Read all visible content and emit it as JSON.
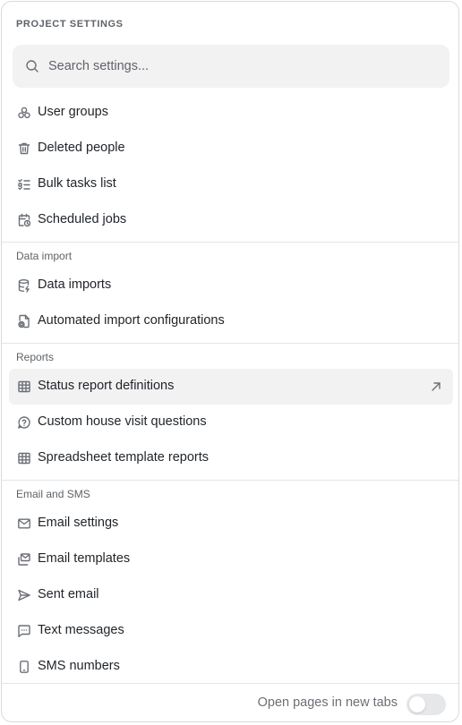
{
  "header": {
    "title": "PROJECT SETTINGS"
  },
  "search": {
    "placeholder": "Search settings..."
  },
  "sections": {
    "general": {
      "items": [
        {
          "label": "User groups",
          "icon": "user-groups-icon"
        },
        {
          "label": "Deleted people",
          "icon": "trash-icon"
        },
        {
          "label": "Bulk tasks list",
          "icon": "checklist-icon"
        },
        {
          "label": "Scheduled jobs",
          "icon": "calendar-clock-icon"
        }
      ]
    },
    "data_import": {
      "title": "Data import",
      "items": [
        {
          "label": "Data imports",
          "icon": "database-icon"
        },
        {
          "label": "Automated import configurations",
          "icon": "file-gear-icon"
        }
      ]
    },
    "reports": {
      "title": "Reports",
      "items": [
        {
          "label": "Status report definitions",
          "icon": "table-icon",
          "active": true,
          "external_icon": "arrow-up-right-icon"
        },
        {
          "label": "Custom house visit questions",
          "icon": "help-circle-icon"
        },
        {
          "label": "Spreadsheet template reports",
          "icon": "table-icon"
        }
      ]
    },
    "email_sms": {
      "title": "Email and SMS",
      "items": [
        {
          "label": "Email settings",
          "icon": "mail-icon"
        },
        {
          "label": "Email templates",
          "icon": "mail-stack-icon"
        },
        {
          "label": "Sent email",
          "icon": "send-icon"
        },
        {
          "label": "Text messages",
          "icon": "message-square-icon"
        },
        {
          "label": "SMS numbers",
          "icon": "smartphone-icon"
        }
      ]
    }
  },
  "footer": {
    "open_new_tabs_label": "Open pages in new tabs",
    "open_new_tabs": false
  }
}
